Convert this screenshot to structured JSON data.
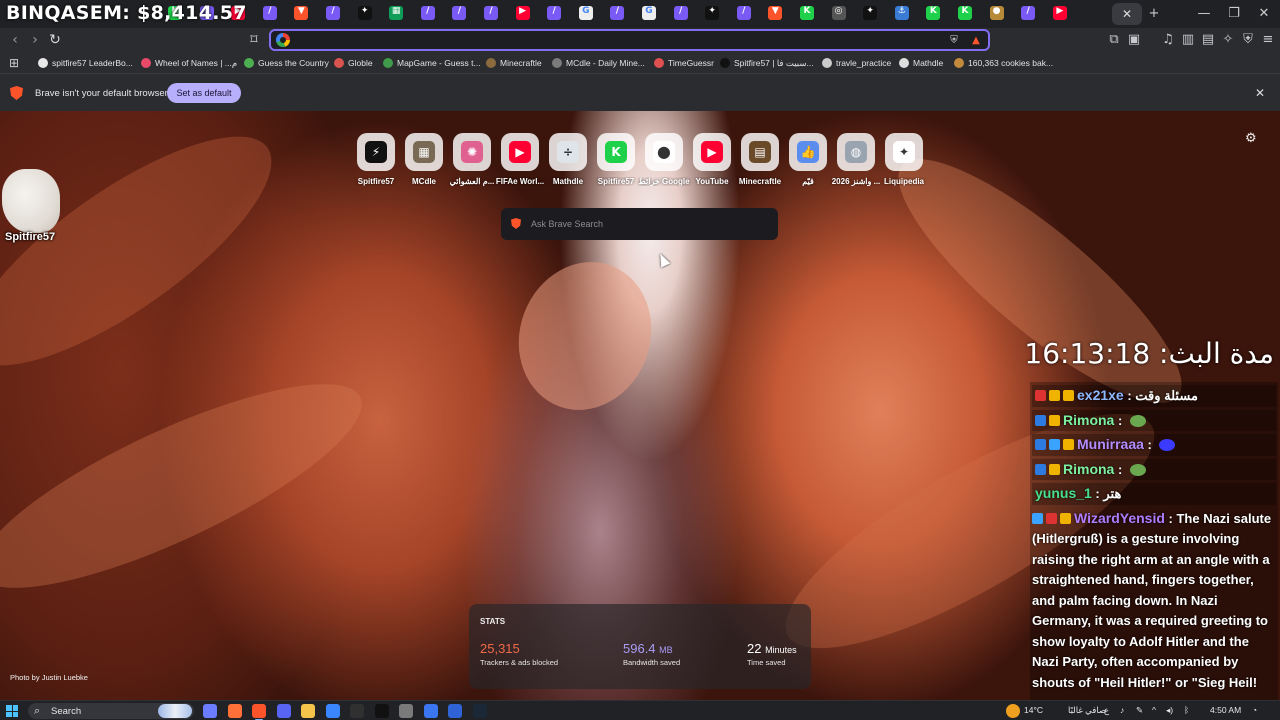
{
  "overlay": {
    "title": "BINQASEM: $8,414.57",
    "uptime": "مدة البث: 16:13:18"
  },
  "tabs": {
    "active_close": "✕",
    "new_tab": "+",
    "items": [
      {
        "icon": "green-k-icon",
        "color": "#1fd14a",
        "glyph": "K"
      },
      {
        "icon": "feather-icon",
        "color": "#7a5af5",
        "glyph": "/"
      },
      {
        "icon": "youtube-icon",
        "color": "#ff0033",
        "glyph": "▶"
      },
      {
        "icon": "feather-icon",
        "color": "#7a5af5",
        "glyph": "/"
      },
      {
        "icon": "brave-icon",
        "color": "#fb542b",
        "glyph": "▼"
      },
      {
        "icon": "feather-icon",
        "color": "#7a5af5",
        "glyph": "/"
      },
      {
        "icon": "spitfire-icon",
        "color": "#111111",
        "glyph": "✦"
      },
      {
        "icon": "sheets-icon",
        "color": "#0f9d58",
        "glyph": "▦"
      },
      {
        "icon": "feather-icon",
        "color": "#7a5af5",
        "glyph": "/"
      },
      {
        "icon": "feather-icon",
        "color": "#7a5af5",
        "glyph": "/"
      },
      {
        "icon": "feather-icon",
        "color": "#7a5af5",
        "glyph": "/"
      },
      {
        "icon": "youtube-icon",
        "color": "#ff0033",
        "glyph": "▶"
      },
      {
        "icon": "feather-icon",
        "color": "#7a5af5",
        "glyph": "/"
      },
      {
        "icon": "google-icon",
        "color": "#eeeeee",
        "glyph": "G"
      },
      {
        "icon": "feather-icon",
        "color": "#7a5af5",
        "glyph": "/"
      },
      {
        "icon": "google-icon",
        "color": "#eeeeee",
        "glyph": "G"
      },
      {
        "icon": "feather-icon",
        "color": "#7a5af5",
        "glyph": "/"
      },
      {
        "icon": "spitfire-icon",
        "color": "#111111",
        "glyph": "✦"
      },
      {
        "icon": "feather-icon",
        "color": "#7a5af5",
        "glyph": "/"
      },
      {
        "icon": "brave-icon",
        "color": "#fb542b",
        "glyph": "▼"
      },
      {
        "icon": "green-k-icon",
        "color": "#1fd14a",
        "glyph": "K"
      },
      {
        "icon": "globe-icon",
        "color": "#555555",
        "glyph": "◎"
      },
      {
        "icon": "spitfire-icon",
        "color": "#111111",
        "glyph": "✦"
      },
      {
        "icon": "anchor-icon",
        "color": "#3a7bd5",
        "glyph": "⚓"
      },
      {
        "icon": "green-k-icon",
        "color": "#1fd14a",
        "glyph": "K"
      },
      {
        "icon": "green-k-icon",
        "color": "#1fd14a",
        "glyph": "K"
      },
      {
        "icon": "cookie-icon",
        "color": "#b78a3a",
        "glyph": "●"
      },
      {
        "icon": "feather-icon",
        "color": "#7a5af5",
        "glyph": "/"
      },
      {
        "icon": "youtube-icon",
        "color": "#ff0033",
        "glyph": "▶"
      }
    ]
  },
  "window": {
    "minimize": "—",
    "maximize": "❐",
    "close": "✕"
  },
  "toolbar": {
    "back": "‹",
    "forward": "›",
    "reload": "↻",
    "bookmark": "⌑",
    "url_value": "",
    "right_icons": [
      "puzzle-icon",
      "screenshot-icon",
      "music-icon",
      "sidebar-icon",
      "wallet-icon",
      "leo-icon",
      "vpn-icon",
      "menu-icon"
    ],
    "right_glyphs": [
      "⧉",
      "▣",
      "♫",
      "▥",
      "▤",
      "✧",
      "⛨",
      "≡"
    ]
  },
  "bookmarks": [
    {
      "label": "spitfire57 LeaderBo...",
      "color": "#e8e8e8"
    },
    {
      "label": "Wheel of Names | ...م",
      "color": "#e84b6a"
    },
    {
      "label": "Guess the Country",
      "color": "#4caf50"
    },
    {
      "label": "Globle",
      "color": "#d9534f"
    },
    {
      "label": "MapGame - Guess t...",
      "color": "#3f9a4a"
    },
    {
      "label": "Minecraftle",
      "color": "#8b6a3e"
    },
    {
      "label": "MCdle - Daily Mine...",
      "color": "#7b7b7b"
    },
    {
      "label": "TimeGuessr",
      "color": "#e05050"
    },
    {
      "label": "Spitfire57 | سبيت فا...",
      "color": "#111111"
    },
    {
      "label": "travle_practice",
      "color": "#cccccc"
    },
    {
      "label": "Mathdle",
      "color": "#dddddd"
    },
    {
      "label": "160,363 cookies bak...",
      "color": "#c18a3c"
    }
  ],
  "infobar": {
    "text": "Brave isn't your default browser",
    "button": "Set as default",
    "close": "✕"
  },
  "ntp": {
    "widget_label": "Spitfire57",
    "search_placeholder": "Ask Brave Search",
    "photo_credit": "Photo by Justin Luebke",
    "tiles": [
      {
        "label": "Spitfire57",
        "icon": "spitfire-icon",
        "bg": "#111111",
        "glyph": "⚡"
      },
      {
        "label": "MCdle",
        "icon": "mcdle-block-icon",
        "bg": "#7a6a55",
        "glyph": "▦"
      },
      {
        "label": "م العشوائي...",
        "icon": "wheel-icon",
        "bg": "#e06090",
        "glyph": "✺"
      },
      {
        "label": "FIFAe Worl...",
        "icon": "youtube-icon",
        "bg": "#ff0033",
        "glyph": "▶"
      },
      {
        "label": "Mathdle",
        "icon": "divide-icon",
        "bg": "#dfe4ea",
        "glyph": "÷"
      },
      {
        "label": "Spitfire57",
        "icon": "kick-icon",
        "bg": "#1fd14a",
        "glyph": "K"
      },
      {
        "label": "خرائط Google",
        "icon": "maps-pin-icon",
        "bg": "#ffffff",
        "glyph": "⬤"
      },
      {
        "label": "YouTube",
        "icon": "youtube-icon",
        "bg": "#ff0033",
        "glyph": "▶"
      },
      {
        "label": "Minecraftle",
        "icon": "crafting-table-icon",
        "bg": "#6b4a2a",
        "glyph": "▤"
      },
      {
        "label": "قيّم",
        "icon": "thumbs-up-icon",
        "bg": "#5b8def",
        "glyph": "👍"
      },
      {
        "label": "2026 واشنز ...",
        "icon": "globe-icon",
        "bg": "#9aa4b0",
        "glyph": "◍"
      },
      {
        "label": "Liquipedia",
        "icon": "liquipedia-icon",
        "bg": "#ffffff",
        "glyph": "✦"
      }
    ]
  },
  "stats": {
    "title": "STATS",
    "trackers_value": "25,315",
    "trackers_label": "Trackers & ads blocked",
    "trackers_color": "#f06a4a",
    "bandwidth_value": "596.4",
    "bandwidth_unit": "MB",
    "bandwidth_label": "Bandwidth saved",
    "bandwidth_color": "#a99cf5",
    "time_value": "22",
    "time_unit": "Minutes",
    "time_label": "Time saved"
  },
  "chat": [
    {
      "user": "ex21xe",
      "sep": " : ",
      "text": "مسئلة وقت",
      "user_color": "#8fb8ff",
      "text_color": "#ffffff",
      "badges": [
        "#d33",
        "#f0b400",
        "#f0b400"
      ],
      "emote": ""
    },
    {
      "user": "Rimona",
      "sep": " : ",
      "text": "",
      "user_color": "#7df0a0",
      "text_color": "#ffffff",
      "badges": [
        "#2d7be0",
        "#f0b400"
      ],
      "emote": "#6aa84f"
    },
    {
      "user": "Munirraaa",
      "sep": " : ",
      "text": "",
      "user_color": "#b48cff",
      "text_color": "#ffffff",
      "badges": [
        "#2d7be0",
        "#3aa3ff",
        "#f0b400"
      ],
      "emote": "#3b3bff"
    },
    {
      "user": "Rimona",
      "sep": " : ",
      "text": "",
      "user_color": "#7df0a0",
      "text_color": "#ffffff",
      "badges": [
        "#2d7be0",
        "#f0b400"
      ],
      "emote": "#6aa84f"
    },
    {
      "user": "yunus_1",
      "sep": " : ",
      "text": "هتر",
      "user_color": "#48e08c",
      "text_color": "#ffffff",
      "badges": [],
      "emote": ""
    },
    {
      "user": "WizardYensid",
      "sep": " : ",
      "text": "The Nazi salute (Hitlergruß) is a gesture involving raising the right arm at an angle with a straightened hand, fingers together, and palm facing down. In Nazi Germany, it was a required greeting to show loyalty to Adolf Hitler and the Nazi Party, often accompanied by shouts of \"Heil Hitler!\" or \"Sieg Heil!",
      "user_color": "#b07cff",
      "text_color": "#ffffff",
      "badges": [
        "#3aa3ff",
        "#d33",
        "#f0b400"
      ],
      "emote": ""
    }
  ],
  "taskbar": {
    "search_label": "Search",
    "weather": "14°C",
    "weather_text": "صافي غالبًا",
    "lang": "ع",
    "clock": "4:50 AM",
    "apps": [
      {
        "icon": "copilot-icon",
        "color": "#6b7cff"
      },
      {
        "icon": "firefox-icon",
        "color": "#ff7139"
      },
      {
        "icon": "brave-icon",
        "color": "#fb542b"
      },
      {
        "icon": "discord-icon",
        "color": "#5865f2"
      },
      {
        "icon": "file-explorer-icon",
        "color": "#f4c54a"
      },
      {
        "icon": "checkmark-app-icon",
        "color": "#3a86ff"
      },
      {
        "icon": "obs-icon",
        "color": "#303030"
      },
      {
        "icon": "tiktok-icon",
        "color": "#111111"
      },
      {
        "icon": "xbox-icon",
        "color": "#7a7a7a"
      },
      {
        "icon": "signal-icon",
        "color": "#3a76f0"
      },
      {
        "icon": "bluetooth-app-icon",
        "color": "#2f63d6"
      },
      {
        "icon": "steam-icon",
        "color": "#1b2838"
      }
    ]
  }
}
